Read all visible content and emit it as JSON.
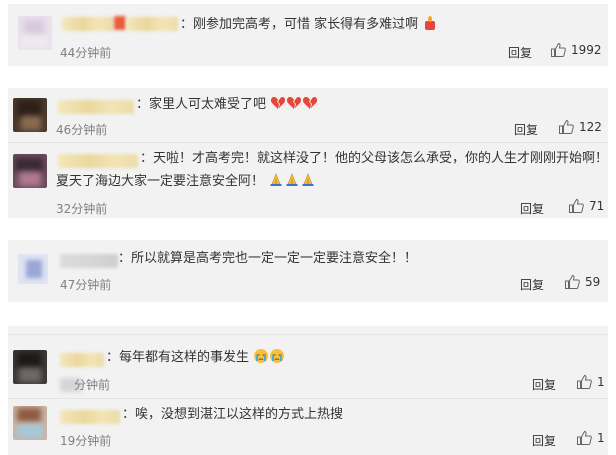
{
  "comments": [
    {
      "text": "：刚参加完高考，可惜 家长得有多难过啊",
      "time": "44分钟前",
      "reply": "回复",
      "likes": "1992",
      "avatar_icon": "blurred-avatar",
      "emojis": [
        "candle-emoji"
      ]
    },
    {
      "text": "：家里人可太难受了吧",
      "time": "46分钟前",
      "reply": "回复",
      "likes": "122",
      "avatar_icon": "blurred-avatar",
      "emojis": [
        "broken-heart-emoji",
        "broken-heart-emoji",
        "broken-heart-emoji"
      ]
    },
    {
      "text_line1": "：天啦！才高考完！就这样没了！他的父母该怎么承受，你的人生才刚刚开始啊！",
      "text_line2": "夏天了海边大家一定要注意安全阿！",
      "time": "32分钟前",
      "reply": "回复",
      "likes": "71",
      "avatar_icon": "blurred-avatar",
      "emojis": [
        "pray-emoji",
        "pray-emoji",
        "pray-emoji"
      ]
    },
    {
      "text": "：所以就算是高考完也一定一定一定要注意安全！！",
      "time": "47分钟前",
      "reply": "回复",
      "likes": "59",
      "avatar_icon": "blurred-avatar"
    },
    {
      "text": "：每年都有这样的事发生",
      "time": "分钟前",
      "reply": "回复",
      "likes": "1",
      "avatar_icon": "blurred-avatar",
      "emojis": [
        "crying-emoji",
        "crying-emoji"
      ]
    },
    {
      "text": "：唉，没想到湛江以这样的方式上热搜",
      "time": "19分钟前",
      "reply": "回复",
      "likes": "1",
      "avatar_icon": "blurred-avatar"
    }
  ],
  "colors": {
    "card_bg": "#f2f2f2",
    "text": "#333333",
    "muted": "#808080",
    "emoji_red": "#e8443a",
    "emoji_yellow": "#f5c23a"
  }
}
